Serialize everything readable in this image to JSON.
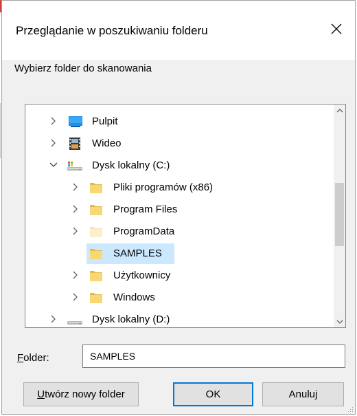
{
  "window": {
    "title": "Przeglądanie w poszukiwaniu folderu",
    "instruction": "Wybierz folder do skanowania"
  },
  "tree": {
    "items": [
      {
        "label": "Pulpit",
        "icon": "desktop-icon",
        "expanded": false
      },
      {
        "label": "Wideo",
        "icon": "video-icon",
        "expanded": false
      },
      {
        "label": "Dysk lokalny (C:)",
        "icon": "drive-icon",
        "expanded": true
      },
      {
        "label": "Pliki programów (x86)",
        "icon": "folder-icon",
        "expanded": false
      },
      {
        "label": "Program Files",
        "icon": "folder-icon",
        "expanded": false
      },
      {
        "label": "ProgramData",
        "icon": "folder-icon",
        "expanded": false,
        "hidden": true
      },
      {
        "label": "SAMPLES",
        "icon": "folder-icon",
        "selected": true
      },
      {
        "label": "Użytkownicy",
        "icon": "folder-icon",
        "expanded": false
      },
      {
        "label": "Windows",
        "icon": "folder-icon",
        "expanded": false
      },
      {
        "label": "Dysk lokalny (D:)",
        "icon": "drive-icon",
        "expanded": false
      }
    ]
  },
  "folder": {
    "label_prefix": "F",
    "label_rest": "older:",
    "value": "SAMPLES"
  },
  "buttons": {
    "new_folder_prefix": "U",
    "new_folder_rest": "twórz nowy folder",
    "ok": "OK",
    "cancel": "Anuluj"
  },
  "colors": {
    "selection": "#cce8ff",
    "accent": "#0078d7",
    "folder": "#f8d775"
  }
}
